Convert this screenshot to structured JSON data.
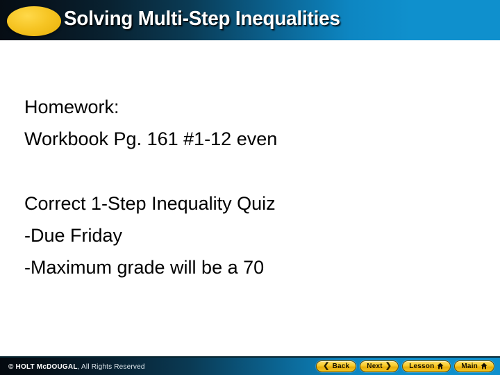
{
  "slide": {
    "title": "Solving Multi-Step Inequalities",
    "accent_color": "#f6c524",
    "header_dark_color": "#060d14",
    "header_blue_color": "#0f90cd",
    "body_text_color": "#000000",
    "background_color": "#ffffff"
  },
  "body": {
    "homework_block": {
      "line1": "Homework:",
      "line2": "Workbook Pg. 161 #1-12 even"
    },
    "quiz_block": {
      "line1": "Correct 1-Step Inequality Quiz",
      "line2": "-Due Friday",
      "line3": "-Maximum grade will be a 70"
    }
  },
  "footer": {
    "copyright_brand": "© HOLT McDOUGAL",
    "copyright_rest": ", All Rights Reserved",
    "buttons": [
      {
        "label": "Back",
        "icon": "chevron-left-icon",
        "glyph": "❮"
      },
      {
        "label": "Next",
        "icon": "chevron-right-icon",
        "glyph": "❯"
      },
      {
        "label": "Lesson",
        "icon": "home-icon",
        "glyph": "⌂"
      },
      {
        "label": "Main",
        "icon": "home-icon",
        "glyph": "⌂"
      }
    ]
  }
}
